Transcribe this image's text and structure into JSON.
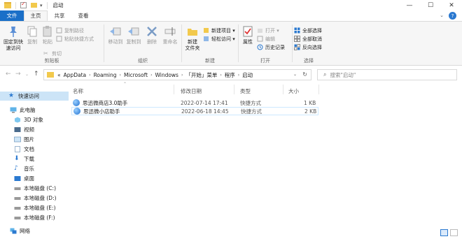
{
  "window": {
    "title": "启动",
    "controls": [
      "—",
      "☐",
      "✕"
    ],
    "quick_access_dropdown": "▾"
  },
  "tabs": [
    {
      "label": "文件",
      "kind": "file"
    },
    {
      "label": "主页",
      "kind": "active"
    },
    {
      "label": "共享",
      "kind": "normal"
    },
    {
      "label": "查看",
      "kind": "normal"
    }
  ],
  "ribbon": {
    "clipboard": {
      "name": "剪贴板",
      "pin": "固定到快\n速访问",
      "copy": "复制",
      "paste": "粘贴",
      "copy_path": "复制路径",
      "paste_shortcut": "粘贴快捷方式",
      "cut": "剪切"
    },
    "organize": {
      "name": "组织",
      "move_to": "移动到",
      "copy_to": "复制到",
      "delete": "删除",
      "rename": "重命名"
    },
    "new": {
      "name": "新建",
      "new_folder": "新建\n文件夹",
      "new_item": "新建项目 ▾",
      "easy_access": "轻松访问 ▾"
    },
    "open": {
      "name": "打开",
      "properties": "属性",
      "open": "打开 ▾",
      "edit": "编辑",
      "history": "历史记录"
    },
    "select": {
      "name": "选择",
      "select_all": "全部选择",
      "select_none": "全部取消",
      "invert": "反向选择"
    }
  },
  "address": {
    "breadcrumb": [
      "AppData",
      "Roaming",
      "Microsoft",
      "Windows",
      "「开始」菜单",
      "程序",
      "启动"
    ],
    "prefix": "«",
    "search_placeholder": "搜索\"启动\""
  },
  "nav_pane": [
    {
      "label": "快速访问",
      "icon": "star-icon",
      "selected": true
    },
    {
      "label": "此电脑",
      "icon": "computer-icon"
    },
    {
      "label": "3D 对象",
      "icon": "cube-icon"
    },
    {
      "label": "视频",
      "icon": "video-icon"
    },
    {
      "label": "图片",
      "icon": "picture-icon"
    },
    {
      "label": "文档",
      "icon": "document-icon"
    },
    {
      "label": "下载",
      "icon": "download-icon"
    },
    {
      "label": "音乐",
      "icon": "music-icon"
    },
    {
      "label": "桌面",
      "icon": "desktop-icon"
    },
    {
      "label": "本地磁盘 (C:)",
      "icon": "drive-icon"
    },
    {
      "label": "本地磁盘 (D:)",
      "icon": "drive-icon"
    },
    {
      "label": "本地磁盘 (E:)",
      "icon": "drive-icon"
    },
    {
      "label": "本地磁盘 (F:)",
      "icon": "drive-icon"
    },
    {
      "label": "网络",
      "icon": "network-icon"
    }
  ],
  "columns": {
    "name": "名称",
    "modified": "修改日期",
    "type": "类型",
    "size": "大小"
  },
  "files": [
    {
      "name": "思迅微商店3.0助手",
      "modified": "2022-07-14 17:41",
      "type": "快捷方式",
      "size": "1 KB"
    },
    {
      "name": "思迅微小店助手",
      "modified": "2022-06-18 14:45",
      "type": "快捷方式",
      "size": "2 KB"
    }
  ],
  "colors": {
    "accent": "#1a6fc8",
    "folder": "#f2c94c",
    "selection": "#cce4f7"
  }
}
